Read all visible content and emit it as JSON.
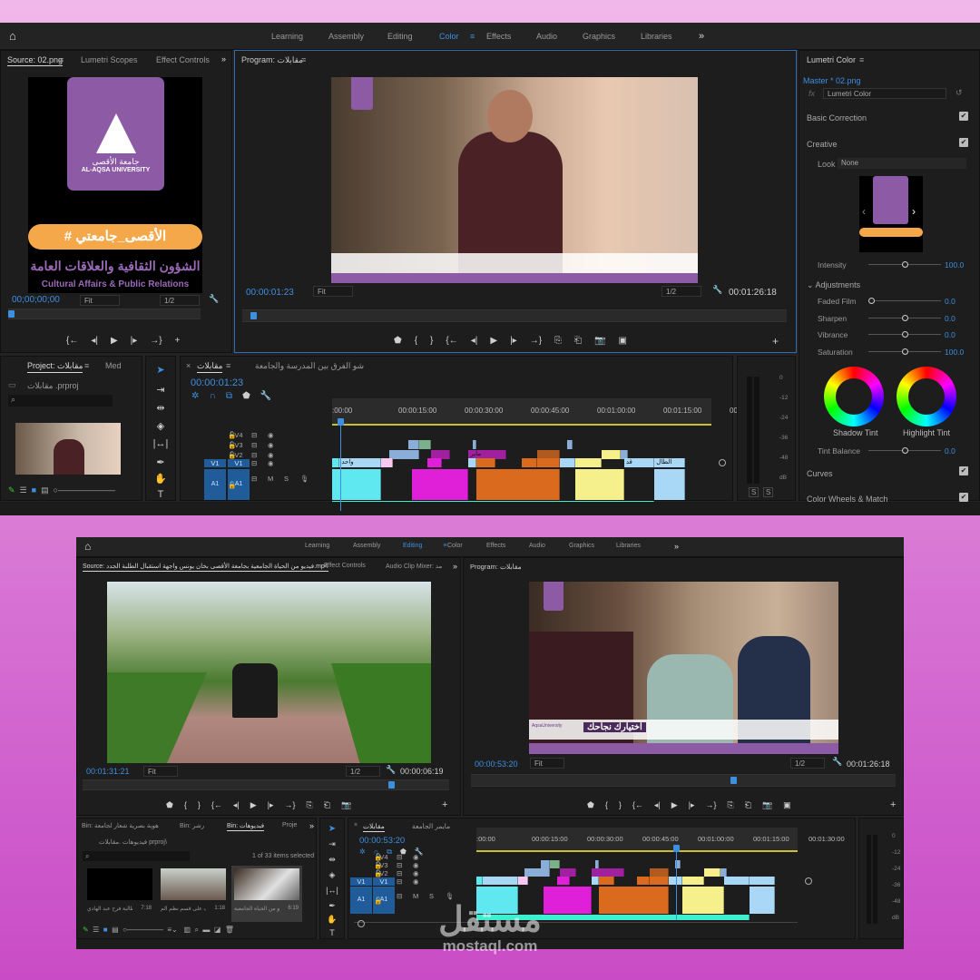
{
  "top": {
    "workspaces": [
      "Learning",
      "Assembly",
      "Editing",
      "Color",
      "Effects",
      "Audio",
      "Graphics",
      "Libraries"
    ],
    "active_workspace": "Color",
    "more": "»",
    "source": {
      "tabs": [
        "Source: 02.png",
        "Lumetri Scopes",
        "Effect Controls"
      ],
      "timecode": "00;00;00;00",
      "fit": "Fit",
      "resolution": "1/2",
      "logo": {
        "arabic_name": "جامعة الأقصى",
        "english_name": "AL-AQSA UNIVERSITY",
        "hashtag": "# الأقصى_جامعتي",
        "dept_ar": "الشؤون الثقافية والعلاقات العامة",
        "dept_en": "Cultural Affairs & Public Relations"
      }
    },
    "program": {
      "title": "Program: مقابلات",
      "timecode": "00:00:01:23",
      "fit": "Fit",
      "resolution": "1/2",
      "duration": "00:01:26:18"
    },
    "lumetri": {
      "title": "Lumetri Color",
      "clip": "Master * 02.png",
      "effect": "Lumetri Color",
      "basic_correction": "Basic Correction",
      "creative": "Creative",
      "look_label": "Look",
      "look_value": "None",
      "intensity_label": "Intensity",
      "intensity": "100.0",
      "adjustments": "Adjustments",
      "sliders": [
        {
          "label": "Faded Film",
          "value": "0.0",
          "level": 0
        },
        {
          "label": "Sharpen",
          "value": "0.0",
          "level": 0.5
        },
        {
          "label": "Vibrance",
          "value": "0.0",
          "level": 0.5
        },
        {
          "label": "Saturation",
          "value": "100.0",
          "level": 0.5
        }
      ],
      "shadow_tint": "Shadow Tint",
      "highlight_tint": "Highlight Tint",
      "tint_balance_label": "Tint Balance",
      "tint_balance": "0.0",
      "curves": "Curves",
      "color_wheels": "Color Wheels & Match"
    },
    "project": {
      "tabs": [
        "Project: مقابلات",
        "Med"
      ],
      "file": "مقابلات .prproj"
    },
    "timeline": {
      "tabs": [
        "مقابلات",
        "شو الفرق بين المدرسة والجامعة"
      ],
      "timecode": "00:00:01:23",
      "ruler": [
        ":00:00",
        "00:00:15:00",
        "00:00:30:00",
        "00:00:45:00",
        "00:01:00:00",
        "00:01:15:00",
        "00:("
      ],
      "tracks": [
        "V4",
        "V3",
        "V2",
        "V1",
        "A1"
      ],
      "clip_labels": [
        "واحد",
        "قد",
        "الطال",
        "ماير"
      ]
    },
    "meter_scale": [
      "0",
      "-12",
      "-24",
      "-36",
      "-48",
      "dB"
    ]
  },
  "bottom": {
    "workspaces": [
      "Learning",
      "Assembly",
      "Editing",
      "Color",
      "Effects",
      "Audio",
      "Graphics",
      "Libraries"
    ],
    "active_workspace": "Editing",
    "source": {
      "tabs": [
        "Source: فيديو من الحياة الجامعية بجامعة الأقصى بخان يونس واجهة استقبال الطلبة الجدد.mp4",
        "Effect Controls",
        "Audio Clip Mixer: مد"
      ],
      "timecode": "00:01:31:21",
      "fit": "Fit",
      "resolution": "1/2",
      "duration": "00:00:06:19"
    },
    "program": {
      "title": "Program: مقابلات",
      "timecode": "00:00:53:20",
      "fit": "Fit",
      "resolution": "1/2",
      "duration": "00:01:26:18",
      "caption": "اختيارك نجاحك",
      "caption_small": "AqsaUniversity"
    },
    "bin": {
      "tabs": [
        "Bin: هوية بصرية شعار لجامعة",
        "Bin: رشر",
        "Bin: فيديوهات",
        "Proje"
      ],
      "path": "فيديوهات .مقابلات prproj\\",
      "selected": "1 of 33 items selected",
      "items": [
        {
          "name": "الطالبة فرح عبد الهادي ...",
          "duration": "7:18"
        },
        {
          "name": "تعرف على قسم نظم الم...",
          "duration": "1:18"
        },
        {
          "name": "فيديو من الحياة الجامعية...",
          "duration": "6:19"
        }
      ]
    },
    "timeline": {
      "tabs": [
        "مقابلات",
        "مايمر الجامعة"
      ],
      "timecode": "00:00:53:20",
      "ruler": [
        ":00:00",
        "00:00:15:00",
        "00:00:30:00",
        "00:00:45:00",
        "00:01:00:00",
        "00:01:15:00",
        "00:01:30:00"
      ],
      "tracks": [
        "V4",
        "V3",
        "V2",
        "V1",
        "A1"
      ]
    },
    "meter_scale": [
      "0",
      "-12",
      "-24",
      "-36",
      "-48",
      "dB"
    ]
  },
  "watermark": {
    "logo": "مستقل",
    "url": "mostaql.com"
  },
  "colors": {
    "accent": "#3d8fe0",
    "cyan": "#5fe8f0",
    "magenta": "#e020d8",
    "orange": "#d96a1e",
    "yellow": "#f5ef8c",
    "lightblue": "#a8d8f5",
    "teal": "#3ef0d0",
    "purple": "#8d5aa6"
  }
}
